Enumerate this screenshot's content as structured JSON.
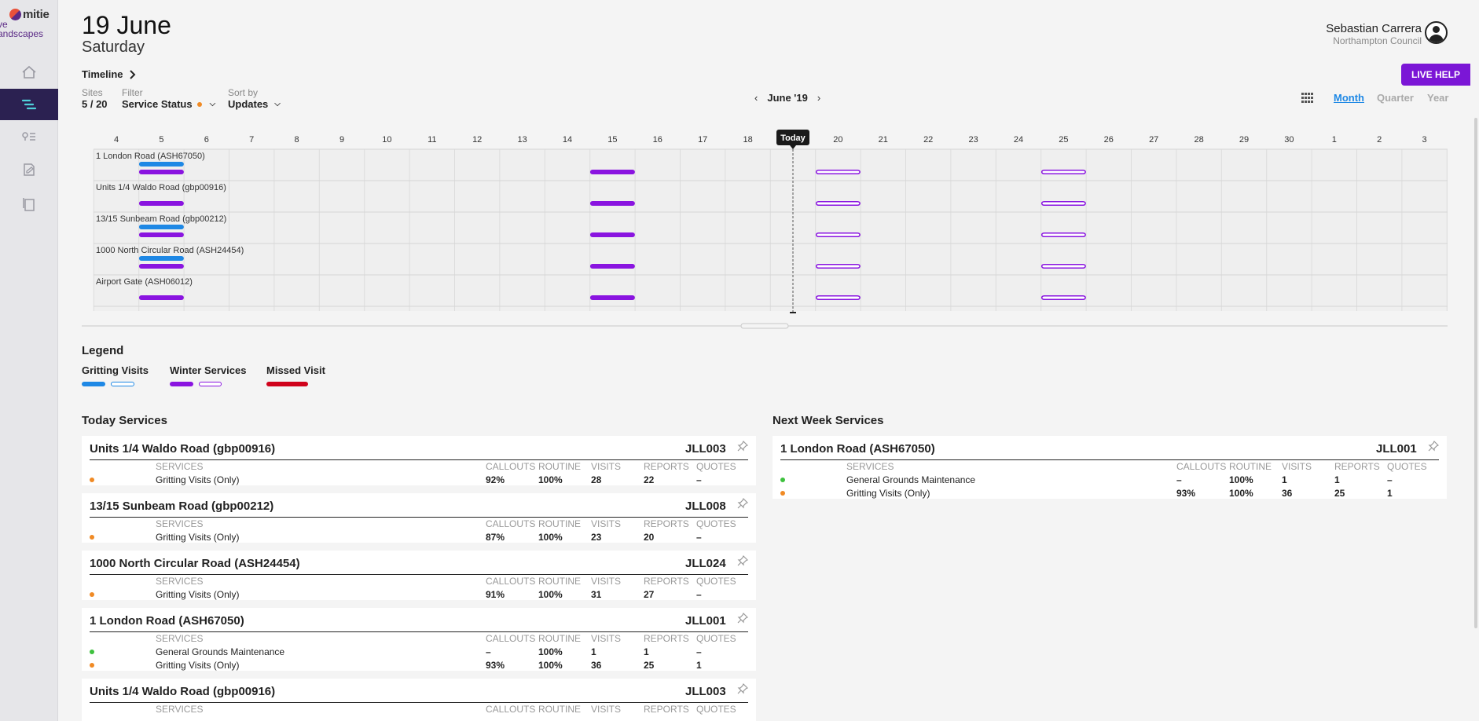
{
  "brand": {
    "name": "mitie",
    "sub_line1": "ve",
    "sub_line2": "andscapes",
    "mark_color_a": "#e8513a",
    "mark_color_b": "#5b2a86"
  },
  "sidebar": {
    "items": [
      {
        "name": "home-icon",
        "active": false
      },
      {
        "name": "timeline-icon",
        "active": true
      },
      {
        "name": "location-list-icon",
        "active": false
      },
      {
        "name": "report-edit-icon",
        "active": false
      },
      {
        "name": "documents-icon",
        "active": false
      }
    ]
  },
  "header": {
    "date": "19 June",
    "day": "Saturday",
    "user_name": "Sebastian Carrera",
    "user_org": "Northampton Council",
    "live_help": "LIVE HELP"
  },
  "controls": {
    "timeline_label": "Timeline",
    "sites_label": "Sites",
    "sites_value": "5 / 20",
    "filter_label": "Filter",
    "filter_value": "Service Status",
    "sort_label": "Sort by",
    "sort_value": "Updates",
    "month_label": "June '19",
    "views": [
      "Month",
      "Quarter",
      "Year"
    ],
    "active_view": "Month"
  },
  "timeline": {
    "days": [
      "4",
      "5",
      "6",
      "7",
      "8",
      "9",
      "10",
      "11",
      "12",
      "13",
      "14",
      "15",
      "16",
      "17",
      "18",
      "Today",
      "20",
      "21",
      "22",
      "23",
      "24",
      "25",
      "26",
      "27",
      "28",
      "29",
      "30",
      "1",
      "2",
      "3"
    ],
    "today_label": "Today",
    "sites": [
      {
        "name": "1 London Road (ASH67050)",
        "gritting": [
          5
        ],
        "winter_done": [
          5,
          15
        ],
        "winter_planned": [
          20,
          25
        ]
      },
      {
        "name": "Units 1/4 Waldo Road (gbp00916)",
        "gritting": [],
        "winter_done": [
          5,
          15
        ],
        "winter_planned": [
          20,
          25
        ]
      },
      {
        "name": "13/15 Sunbeam Road (gbp00212)",
        "gritting": [
          5
        ],
        "winter_done": [
          5,
          15
        ],
        "winter_planned": [
          20,
          25
        ]
      },
      {
        "name": "1000 North Circular Road (ASH24454)",
        "gritting": [
          5
        ],
        "winter_done": [
          5,
          15
        ],
        "winter_planned": [
          20,
          25
        ]
      },
      {
        "name": "Airport Gate (ASH06012)",
        "gritting": [],
        "winter_done": [
          5,
          15
        ],
        "winter_planned": [
          20,
          25
        ]
      }
    ],
    "colors": {
      "gritting": "#1e88e5",
      "winter": "#8a14e0",
      "missed": "#d0021b"
    }
  },
  "legend": {
    "title": "Legend",
    "items": [
      {
        "label": "Gritting Visits"
      },
      {
        "label": "Winter Services"
      },
      {
        "label": "Missed Visit"
      }
    ]
  },
  "columns": [
    "SERVICES",
    "CALLOUTS",
    "ROUTINE",
    "VISITS",
    "REPORTS",
    "QUOTES"
  ],
  "today_services": {
    "title": "Today Services",
    "cards": [
      {
        "site": "Units 1/4 Waldo Road (gbp00916)",
        "code": "JLL003",
        "rows": [
          {
            "status": "orange",
            "service": "Gritting Visits (Only)",
            "callouts": "92%",
            "routine": "100%",
            "visits": "28",
            "reports": "22",
            "quotes": "–"
          }
        ]
      },
      {
        "site": "13/15 Sunbeam Road (gbp00212)",
        "code": "JLL008",
        "rows": [
          {
            "status": "orange",
            "service": "Gritting Visits (Only)",
            "callouts": "87%",
            "routine": "100%",
            "visits": "23",
            "reports": "20",
            "quotes": "–"
          }
        ]
      },
      {
        "site": "1000 North Circular Road (ASH24454)",
        "code": "JLL024",
        "rows": [
          {
            "status": "orange",
            "service": "Gritting Visits (Only)",
            "callouts": "91%",
            "routine": "100%",
            "visits": "31",
            "reports": "27",
            "quotes": "–"
          }
        ]
      },
      {
        "site": "1 London Road (ASH67050)",
        "code": "JLL001",
        "rows": [
          {
            "status": "green",
            "service": "General Grounds Maintenance",
            "callouts": "–",
            "routine": "100%",
            "visits": "1",
            "reports": "1",
            "quotes": "–"
          },
          {
            "status": "orange",
            "service": "Gritting Visits (Only)",
            "callouts": "93%",
            "routine": "100%",
            "visits": "36",
            "reports": "25",
            "quotes": "1"
          }
        ]
      },
      {
        "site": "Units 1/4 Waldo Road (gbp00916)",
        "code": "JLL003",
        "rows": []
      }
    ]
  },
  "next_week_services": {
    "title": "Next Week Services",
    "cards": [
      {
        "site": "1 London Road (ASH67050)",
        "code": "JLL001",
        "rows": [
          {
            "status": "green",
            "service": "General Grounds Maintenance",
            "callouts": "–",
            "routine": "100%",
            "visits": "1",
            "reports": "1",
            "quotes": "–"
          },
          {
            "status": "orange",
            "service": "Gritting Visits (Only)",
            "callouts": "93%",
            "routine": "100%",
            "visits": "36",
            "reports": "25",
            "quotes": "1"
          }
        ]
      }
    ]
  },
  "status_colors": {
    "orange": "#f08a24",
    "green": "#3ec13e"
  }
}
